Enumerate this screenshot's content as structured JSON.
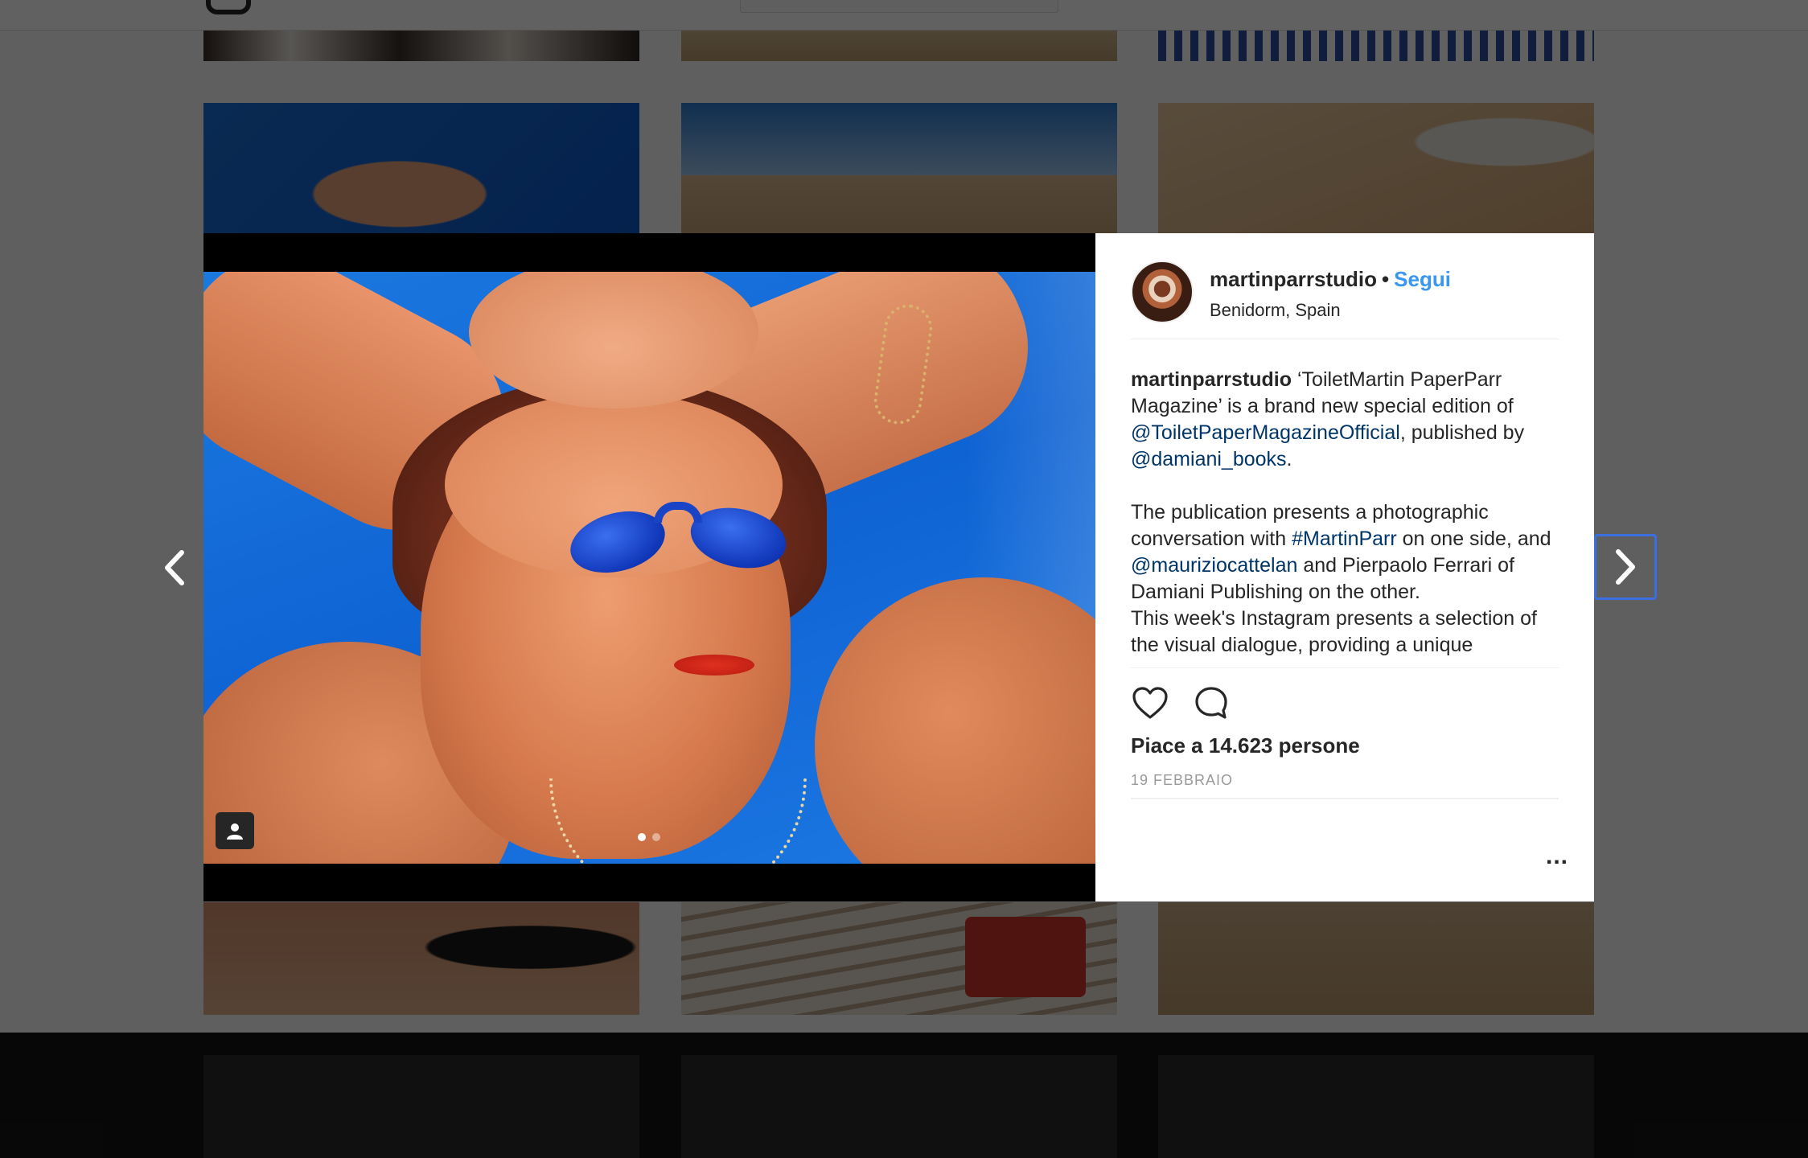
{
  "post": {
    "username": "martinparrstudio",
    "separator": "•",
    "follow_label": "Segui",
    "location": "Benidorm, Spain",
    "caption": {
      "username": "martinparrstudio",
      "p1_a": "‘ToiletMartin PaperParr Magazine’ is a brand new special edition of ",
      "mention1": "@ToiletPaperMagazineOfficial",
      "p1_b": ", published by ",
      "mention2": "@damiani_books",
      "p1_c": ".",
      "p2_a": "The publication presents a photographic conversation with ",
      "hashtag1": "#MartinParr",
      "p2_b": " on one side, and ",
      "mention3": "@mauriziocattelan",
      "p2_c": " and Pierpaolo Ferrari of Damiani Publishing on the other.",
      "p3": "This week's Instagram presents a selection of the visual dialogue, providing a unique"
    },
    "likes_text": "Piace a 14.623 persone",
    "date": "19 febbraio",
    "more_label": "...",
    "carousel": {
      "total": 2,
      "current": 1
    }
  },
  "icons": {
    "tag": "user-tag-icon",
    "like": "heart-icon",
    "comment": "comment-icon",
    "prev": "chevron-left-icon",
    "next": "chevron-right-icon"
  },
  "colors": {
    "link": "#003569",
    "follow": "#3897f0",
    "text": "#262626",
    "muted": "#999999",
    "focus_ring": "#3b6fe0"
  }
}
